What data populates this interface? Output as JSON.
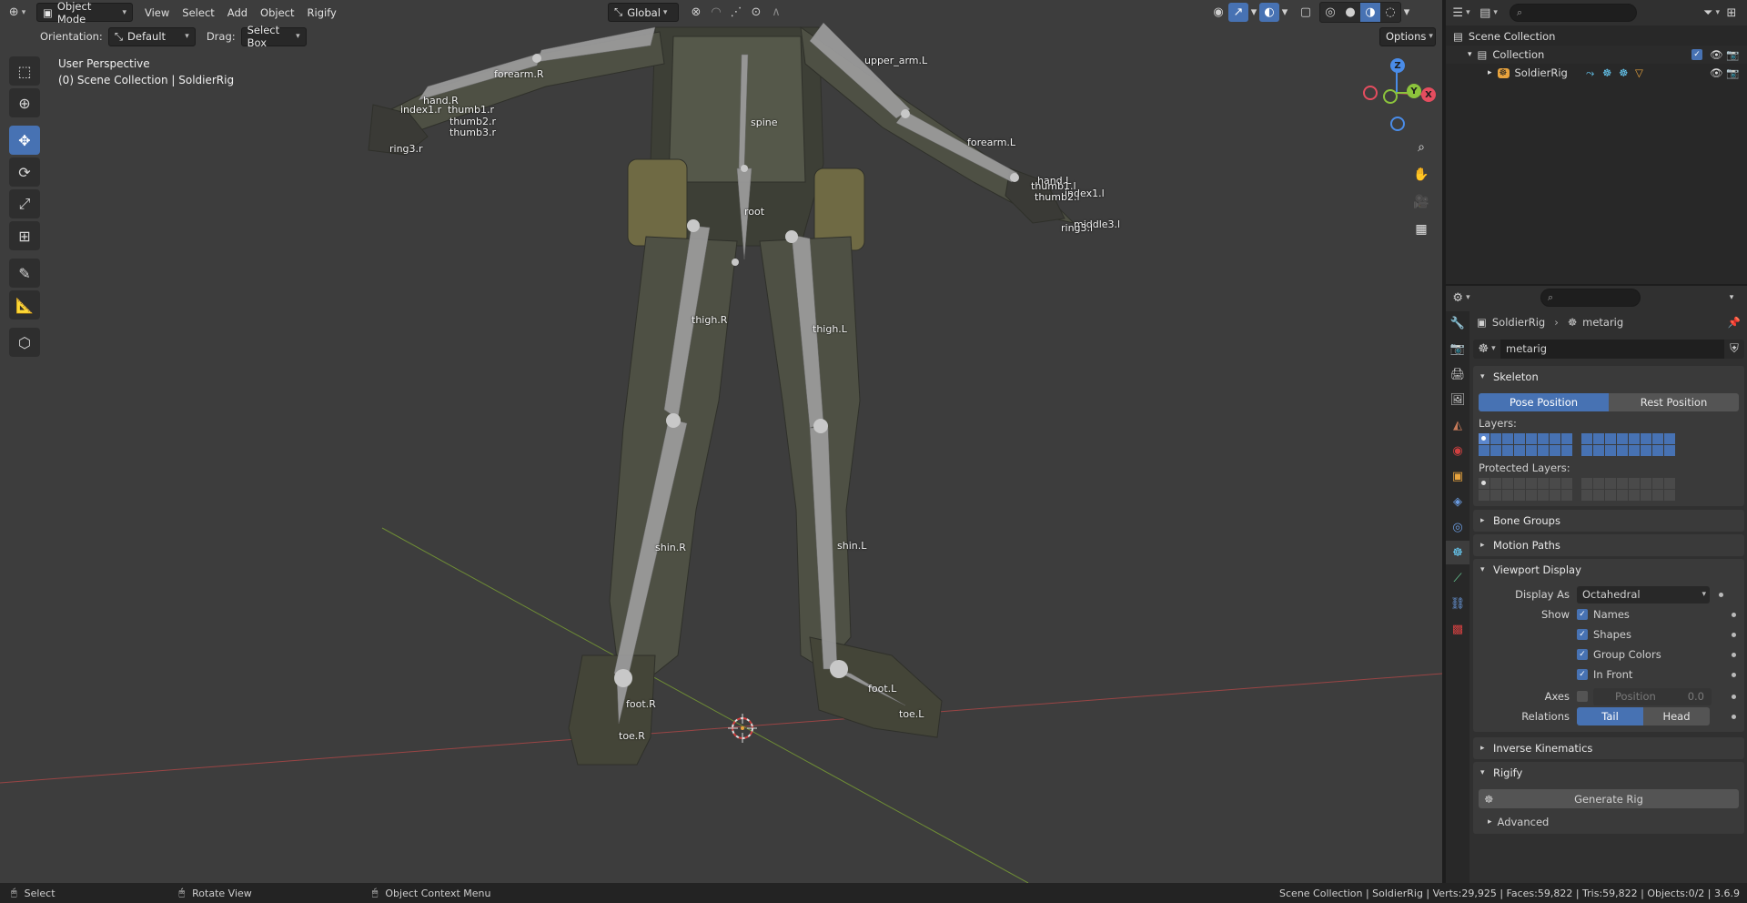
{
  "header": {
    "editor_type_icon": "3d-viewport-icon",
    "mode": "Object Mode",
    "menus": [
      "View",
      "Select",
      "Add",
      "Object",
      "Rigify"
    ],
    "transform_orientation": "Global",
    "pivot_icon": "pivot-icon",
    "snap_icon": "snap-magnet-icon",
    "proportional_icon": "proportional-edit-icon"
  },
  "subheader": {
    "orientation_label": "Orientation:",
    "orientation_value": "Default",
    "drag_label": "Drag:",
    "drag_value": "Select Box",
    "options_label": "Options"
  },
  "viewport": {
    "view_name": "User Perspective",
    "context": "(0) Scene Collection | SoldierRig",
    "gizmo_axes": [
      "X",
      "Y",
      "Z"
    ],
    "bone_labels": [
      {
        "text": "upper_arm.L"
      },
      {
        "text": "forearm.R"
      },
      {
        "text": "forearm.L"
      },
      {
        "text": "hand.R"
      },
      {
        "text": "hand.L"
      },
      {
        "text": "spine"
      },
      {
        "text": "root"
      },
      {
        "text": "thigh.R"
      },
      {
        "text": "thigh.L"
      },
      {
        "text": "shin.R"
      },
      {
        "text": "shin.L"
      },
      {
        "text": "foot.R"
      },
      {
        "text": "foot.L"
      },
      {
        "text": "toe.R"
      },
      {
        "text": "toe.L"
      },
      {
        "text": "thumb1.r"
      },
      {
        "text": "thumb2.r"
      },
      {
        "text": "thumb3.r"
      },
      {
        "text": "index1.r"
      },
      {
        "text": "index1.l"
      },
      {
        "text": "thumb1.l"
      },
      {
        "text": "thumb2.l"
      },
      {
        "text": "middle3.l"
      },
      {
        "text": "ring3.r"
      },
      {
        "text": "ring3.l"
      }
    ]
  },
  "tools": [
    "select-box-tool",
    "cursor-tool",
    "move-tool",
    "rotate-tool",
    "scale-tool",
    "transform-tool",
    "annotate-tool",
    "measure-tool",
    "add-cube-tool"
  ],
  "outliner": {
    "search_placeholder": "",
    "items": [
      {
        "label": "Scene Collection",
        "indent": 0
      },
      {
        "label": "Collection",
        "indent": 1
      },
      {
        "label": "SoldierRig",
        "indent": 2
      }
    ]
  },
  "properties": {
    "breadcrumb_object": "SoldierRig",
    "breadcrumb_data": "metarig",
    "data_name": "metarig",
    "skeleton": {
      "title": "Skeleton",
      "pose_position": "Pose Position",
      "rest_position": "Rest Position",
      "layers_label": "Layers:",
      "protected_layers_label": "Protected Layers:"
    },
    "bone_groups": "Bone Groups",
    "motion_paths": "Motion Paths",
    "viewport_display": {
      "title": "Viewport Display",
      "display_as_label": "Display As",
      "display_as_value": "Octahedral",
      "show_label": "Show",
      "names": "Names",
      "shapes": "Shapes",
      "group_colors": "Group Colors",
      "in_front": "In Front",
      "axes_label": "Axes",
      "axes_position_label": "Position",
      "axes_position_value": "0.0",
      "relations_label": "Relations",
      "relations_tail": "Tail",
      "relations_head": "Head"
    },
    "inverse_kinematics": "Inverse Kinematics",
    "rigify": {
      "title": "Rigify",
      "generate_rig": "Generate Rig",
      "advanced": "Advanced"
    }
  },
  "statusbar": {
    "left_select": "Select",
    "mid_rotate": "Rotate View",
    "context_menu": "Object Context Menu",
    "stats": "Scene Collection | SoldierRig | Verts:29,925 | Faces:59,822 | Tris:59,822 | Objects:0/2 | 3.6.9"
  },
  "colors": {
    "accent": "#4772b3",
    "viewport_bg": "#3d3d3d",
    "axis_x": "#e54d5f",
    "axis_y": "#8cc43c",
    "axis_z": "#4a8ce8"
  }
}
